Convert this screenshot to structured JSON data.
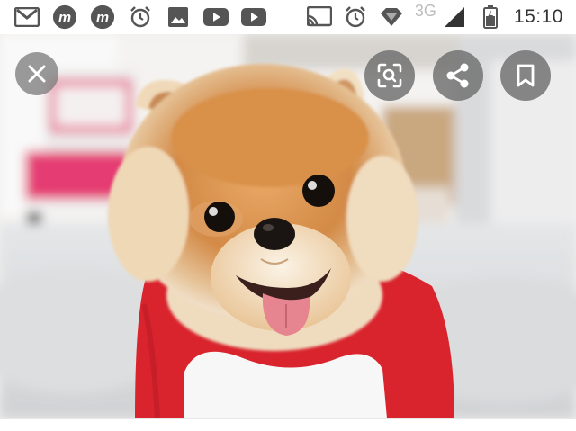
{
  "status_bar": {
    "left_icons": [
      "gmail-icon",
      "m-app-icon",
      "m-app-icon",
      "alarm-icon",
      "gallery-icon",
      "youtube-icon",
      "youtube-icon"
    ],
    "right_icons": [
      "cast-icon",
      "alarm-icon",
      "data-saver-icon",
      "signal-icon",
      "battery-icon"
    ],
    "network": "3G",
    "time": "15:10"
  },
  "viewer": {
    "photo_subject": "pomeranian-dog-photo",
    "buttons": [
      "close-button",
      "lens-button",
      "share-button",
      "save-button"
    ]
  },
  "colors": {
    "overlay_button": "#6e6e6e",
    "icon_gray": "#444444",
    "shirt_red": "#d9232d"
  }
}
